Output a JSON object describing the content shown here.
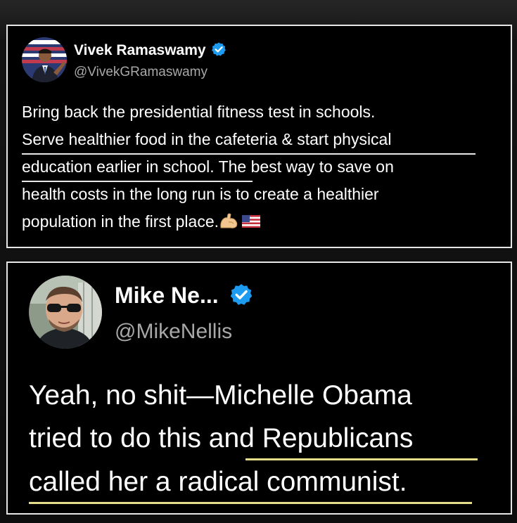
{
  "tweet1": {
    "display_name": "Vivek Ramaswamy",
    "handle": "@VivekGRamaswamy",
    "lines": [
      "Bring back the presidential fitness test in schools.",
      "Serve healthier food in the cafeteria & start physical",
      "education earlier in school. The best way to save on",
      "health costs in the long run is to create a healthier",
      "population in the first place."
    ],
    "emojis": [
      "flexed-biceps-emoji",
      "us-flag-emoji"
    ],
    "avatar": "profile-photo"
  },
  "tweet2": {
    "display_name": "Mike Ne...",
    "handle": "@MikeNellis",
    "lines": [
      "Yeah, no shit—Michelle Obama",
      "tried to do this and Republicans",
      "called her a radical communist."
    ],
    "avatar": "profile-photo"
  },
  "colors": {
    "background": "#111111",
    "card": "#000000",
    "card_border": "#e6e6e6",
    "verified_badge": "#1d9bf0",
    "handle_text": "#a8a8a8",
    "highlight_underline": "#e6dd8a"
  }
}
